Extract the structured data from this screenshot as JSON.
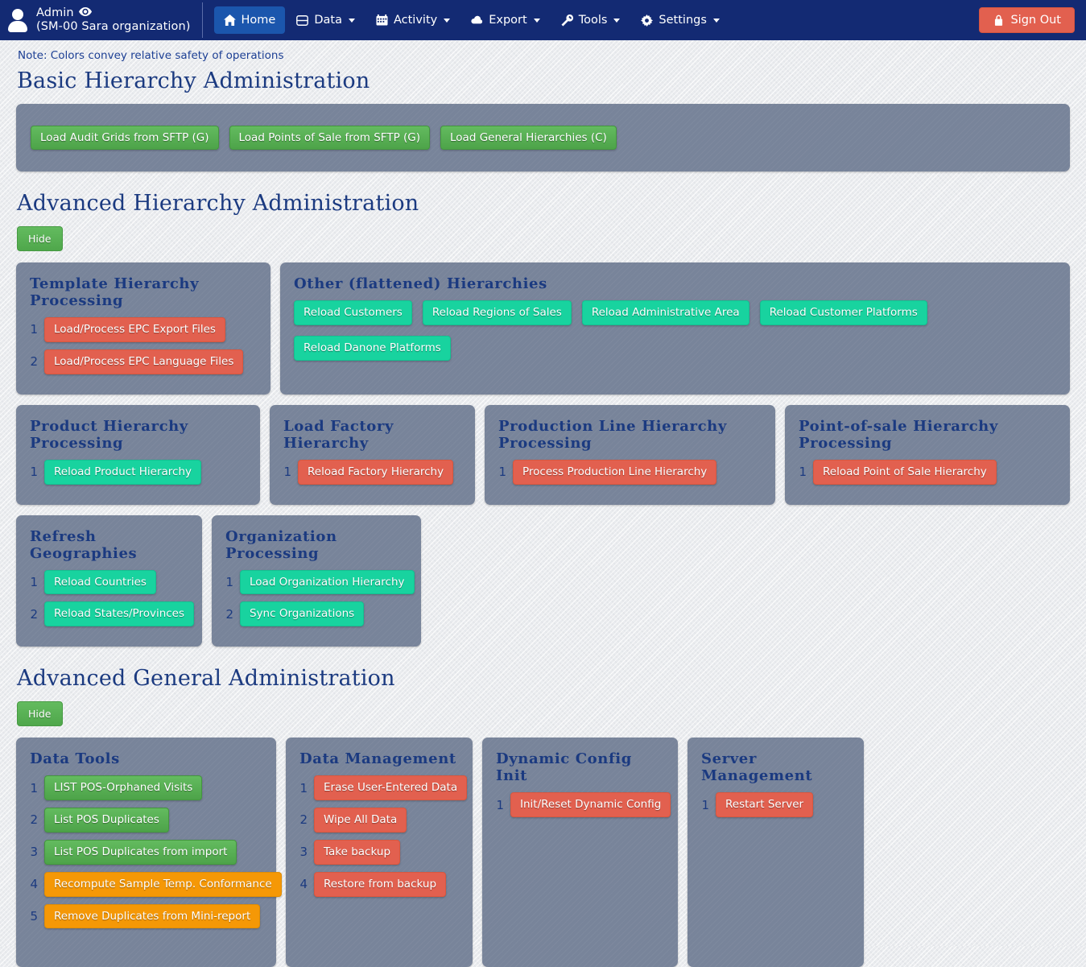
{
  "navbar": {
    "user_name": "Admin",
    "user_org": "(SM-00 Sara organization)",
    "eye_icon": "eye-icon",
    "avatar_icon": "user-avatar-icon",
    "items": [
      {
        "label": "Home",
        "icon": "home-icon",
        "caret": false,
        "active": true
      },
      {
        "label": "Data",
        "icon": "database-icon",
        "caret": true,
        "active": false
      },
      {
        "label": "Activity",
        "icon": "calendar-icon",
        "caret": true,
        "active": false
      },
      {
        "label": "Export",
        "icon": "cloud-icon",
        "caret": true,
        "active": false
      },
      {
        "label": "Tools",
        "icon": "wrench-icon",
        "caret": true,
        "active": false
      },
      {
        "label": "Settings",
        "icon": "gear-icon",
        "caret": true,
        "active": false
      }
    ],
    "signout_label": "Sign Out",
    "signout_icon": "lock-icon"
  },
  "note": "Note: Colors convey relative safety of operations",
  "sections": {
    "basic": {
      "title": "Basic Hierarchy Administration",
      "buttons": [
        {
          "label": "Load Audit Grids from SFTP (G)",
          "color": "green"
        },
        {
          "label": "Load Points of Sale from SFTP (G)",
          "color": "green"
        },
        {
          "label": "Load General Hierarchies (C)",
          "color": "green"
        }
      ]
    },
    "advanced_hierarchy": {
      "title": "Advanced Hierarchy Administration",
      "hide_label": "Hide",
      "row1": [
        {
          "title": "Template Hierarchy Processing",
          "tasks": [
            {
              "num": "1",
              "label": "Load/Process EPC Export Files",
              "color": "red"
            },
            {
              "num": "2",
              "label": "Load/Process EPC Language Files",
              "color": "red"
            }
          ]
        },
        {
          "title": "Other (flattened) Hierarchies",
          "flat": [
            {
              "label": "Reload Customers",
              "color": "teal"
            },
            {
              "label": "Reload Regions of Sales",
              "color": "teal"
            },
            {
              "label": "Reload Administrative Area",
              "color": "teal"
            },
            {
              "label": "Reload Customer Platforms",
              "color": "teal"
            },
            {
              "label": "Reload Danone Platforms",
              "color": "teal"
            }
          ]
        }
      ],
      "row2": [
        {
          "title": "Product Hierarchy Processing",
          "tasks": [
            {
              "num": "1",
              "label": "Reload Product Hierarchy",
              "color": "teal"
            }
          ]
        },
        {
          "title": "Load Factory Hierarchy",
          "tasks": [
            {
              "num": "1",
              "label": "Reload Factory Hierarchy",
              "color": "red"
            }
          ]
        },
        {
          "title": "Production Line Hierarchy Processing",
          "tasks": [
            {
              "num": "1",
              "label": "Process Production Line Hierarchy",
              "color": "red"
            }
          ]
        },
        {
          "title": "Point-of-sale Hierarchy Processing",
          "tasks": [
            {
              "num": "1",
              "label": "Reload Point of Sale Hierarchy",
              "color": "red"
            }
          ]
        }
      ],
      "row3": [
        {
          "title": "Refresh Geographies",
          "tasks": [
            {
              "num": "1",
              "label": "Reload Countries",
              "color": "teal"
            },
            {
              "num": "2",
              "label": "Reload States/Provinces",
              "color": "teal"
            }
          ]
        },
        {
          "title": "Organization Processing",
          "tasks": [
            {
              "num": "1",
              "label": "Load Organization Hierarchy",
              "color": "teal"
            },
            {
              "num": "2",
              "label": "Sync Organizations",
              "color": "teal"
            }
          ]
        }
      ]
    },
    "advanced_general": {
      "title": "Advanced General Administration",
      "hide_label": "Hide",
      "cards": [
        {
          "title": "Data Tools",
          "tasks": [
            {
              "num": "1",
              "label": "LIST POS-Orphaned Visits",
              "color": "green"
            },
            {
              "num": "2",
              "label": "List POS Duplicates",
              "color": "green"
            },
            {
              "num": "3",
              "label": "List POS Duplicates from import",
              "color": "green"
            },
            {
              "num": "4",
              "label": "Recompute Sample Temp. Conformance",
              "color": "orange"
            },
            {
              "num": "5",
              "label": "Remove Duplicates from Mini-report",
              "color": "orange"
            }
          ]
        },
        {
          "title": "Data Management",
          "tasks": [
            {
              "num": "1",
              "label": "Erase User-Entered Data",
              "color": "red"
            },
            {
              "num": "2",
              "label": "Wipe All Data",
              "color": "red"
            },
            {
              "num": "3",
              "label": "Take backup",
              "color": "red"
            },
            {
              "num": "4",
              "label": "Restore from backup",
              "color": "red"
            }
          ]
        },
        {
          "title": "Dynamic Config Init",
          "tasks": [
            {
              "num": "1",
              "label": "Init/Reset Dynamic Config",
              "color": "red"
            }
          ]
        },
        {
          "title": "Server Management",
          "tasks": [
            {
              "num": "1",
              "label": "Restart Server",
              "color": "red"
            }
          ]
        }
      ]
    }
  },
  "colors": {
    "navbar_bg": "#132a73",
    "navbar_active": "#1b56ad",
    "card_bg": "#78849a",
    "heading": "#1b3a80",
    "green": "#55ab50",
    "red": "#e2604f",
    "teal": "#18d39f",
    "orange": "#f59806",
    "page_bg": "#e9ebee"
  }
}
